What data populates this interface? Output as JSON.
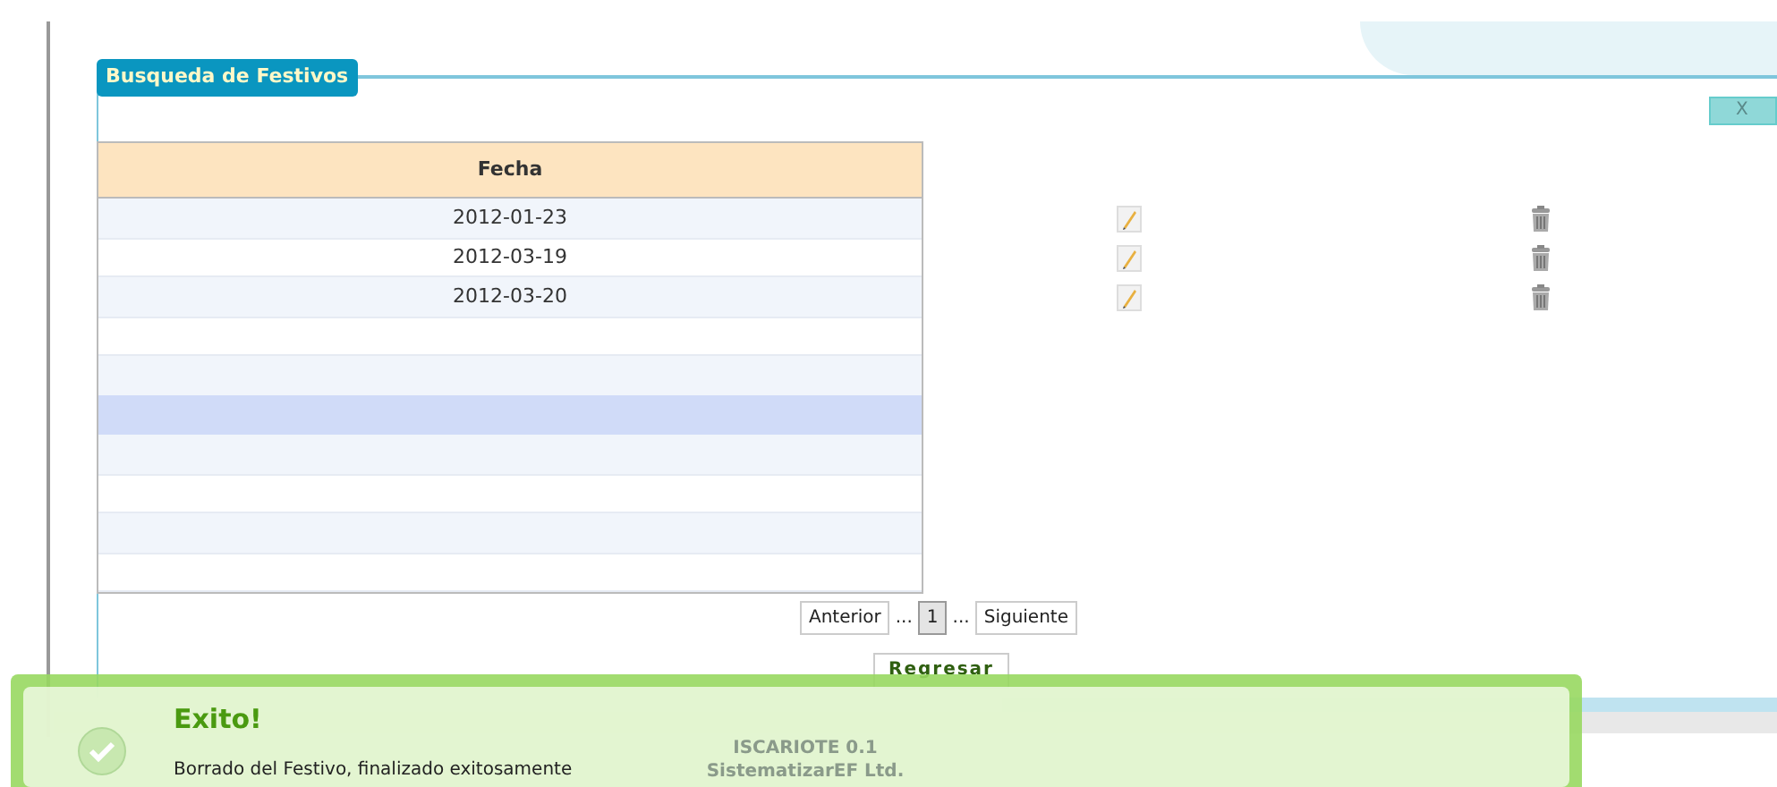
{
  "panel": {
    "title": "Busqueda de Festivos",
    "close_label": "X"
  },
  "table": {
    "columns": [
      "Fecha"
    ],
    "rows": [
      {
        "fecha": "2012-01-23",
        "selected": false
      },
      {
        "fecha": "2012-03-19",
        "selected": false
      },
      {
        "fecha": "2012-03-20",
        "selected": false
      },
      {
        "selected": false
      },
      {
        "selected": false
      },
      {
        "selected": true
      },
      {
        "selected": false
      },
      {
        "selected": false
      },
      {
        "selected": false
      },
      {
        "selected": false
      }
    ]
  },
  "pagination": {
    "previous": "Anterior",
    "ellipsis_before": "...",
    "pages": [
      {
        "label": "1",
        "selected": true
      }
    ],
    "ellipsis_after": "...",
    "next": "Siguiente"
  },
  "back_button": "Regresar",
  "footer": [
    "ISCARIOTE 0.1",
    "SistematizarEF Ltd."
  ],
  "notification": {
    "title": "Exito!",
    "message": "Borrado del Festivo, finalizado exitosamente"
  }
}
